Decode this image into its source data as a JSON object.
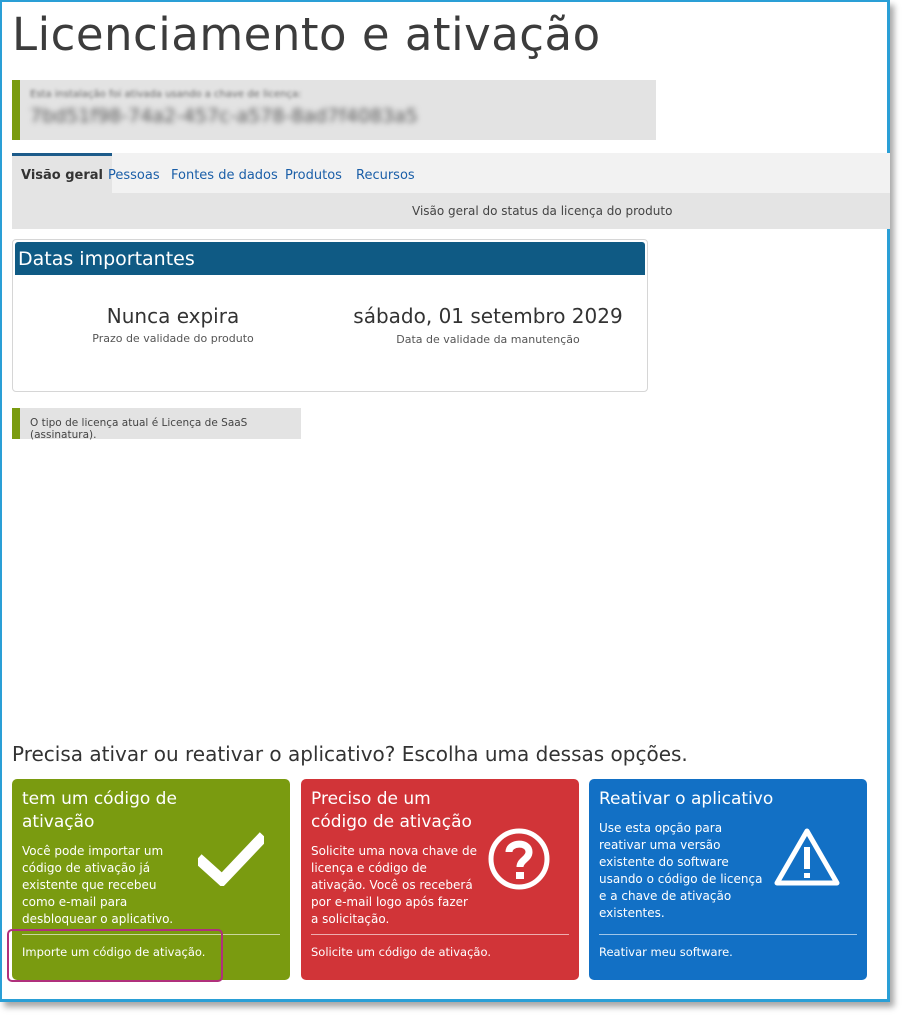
{
  "page_title": "Licenciamento e ativação",
  "license_box": {
    "caption": "Esta instalação foi ativada usando a chave de licença:",
    "key": "7bd51f98-74a2-457c-a578-8ad7f4083a5"
  },
  "tabs": [
    {
      "label": "Visão geral"
    },
    {
      "label": "Pessoas"
    },
    {
      "label": "Fontes de dados"
    },
    {
      "label": "Produtos"
    },
    {
      "label": "Recursos"
    }
  ],
  "subbar_text": "Visão geral do status da licença do produto",
  "important_dates": {
    "header": "Datas importantes",
    "expiry_value": "Nunca expira",
    "expiry_label": "Prazo de validade do produto",
    "maintenance_value": "sábado, 01 setembro 2029",
    "maintenance_label": "Data de validade da manutenção"
  },
  "license_type_text": "O tipo de licença atual é Licença de SaaS (assinatura).",
  "question": "Precisa ativar ou reativar o aplicativo? Escolha uma dessas opções.",
  "options": [
    {
      "title_line1": "tem um código de",
      "title_line2": "ativação",
      "text_lines": [
        "Você pode importar um",
        "código de ativação já",
        "existente que recebeu",
        "como e-mail para",
        "desbloquear o aplicativo."
      ],
      "link": "Importe um código de ativação.",
      "icon": "checkmark-icon",
      "color": "#7a9b10"
    },
    {
      "title_line1": "Preciso de um",
      "title_line2": "código de ativação",
      "text_lines": [
        "Solicite uma nova chave de",
        "licença e código de",
        "ativação. Você os receberá",
        "por e-mail logo após fazer",
        "a solicitação."
      ],
      "link": "Solicite um código de ativação.",
      "icon": "question-circle-icon",
      "color": "#d13438"
    },
    {
      "title_line1": "Reativar o aplicativo",
      "title_line2": "",
      "text_lines": [
        "Use esta opção para",
        "reativar uma versão",
        "existente do software",
        "usando o código de licença",
        "e a chave de ativação",
        "existentes."
      ],
      "link": "Reativar meu software.",
      "icon": "warning-triangle-icon",
      "color": "#1270c5"
    }
  ]
}
